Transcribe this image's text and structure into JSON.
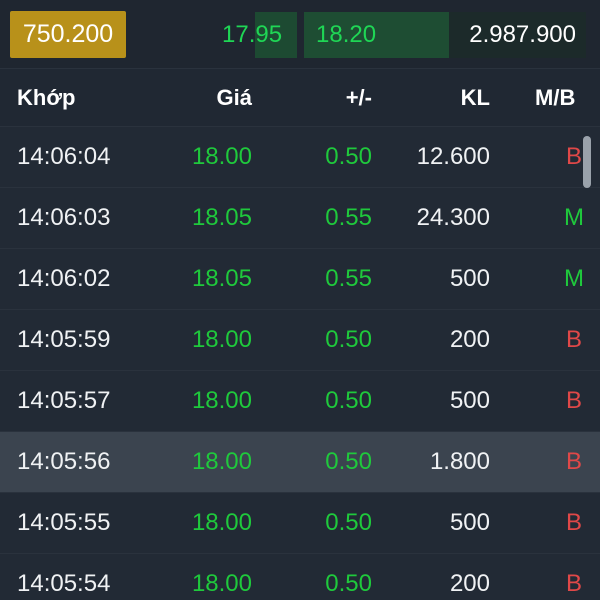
{
  "top": {
    "total_volume": "750.200",
    "bid_price": "17.95",
    "ask_price": "18.20",
    "ask_volume": "2.987.900"
  },
  "table": {
    "headers": {
      "time": "Khớp",
      "price": "Giá",
      "change": "+/-",
      "volume": "KL",
      "side": "M/B"
    },
    "rows": [
      {
        "time": "14:06:04",
        "price": "18.00",
        "change": "0.50",
        "volume": "12.600",
        "side": "B"
      },
      {
        "time": "14:06:03",
        "price": "18.05",
        "change": "0.55",
        "volume": "24.300",
        "side": "M"
      },
      {
        "time": "14:06:02",
        "price": "18.05",
        "change": "0.55",
        "volume": "500",
        "side": "M"
      },
      {
        "time": "14:05:59",
        "price": "18.00",
        "change": "0.50",
        "volume": "200",
        "side": "B"
      },
      {
        "time": "14:05:57",
        "price": "18.00",
        "change": "0.50",
        "volume": "500",
        "side": "B"
      },
      {
        "time": "14:05:56",
        "price": "18.00",
        "change": "0.50",
        "volume": "1.800",
        "side": "B"
      },
      {
        "time": "14:05:55",
        "price": "18.00",
        "change": "0.50",
        "volume": "500",
        "side": "B"
      },
      {
        "time": "14:05:54",
        "price": "18.00",
        "change": "0.50",
        "volume": "200",
        "side": "B"
      }
    ]
  },
  "colors": {
    "up_green": "#1fc93c",
    "sell_red": "#e04848",
    "badge_gold": "#b8911a",
    "highlight_row": "#3b444f"
  }
}
